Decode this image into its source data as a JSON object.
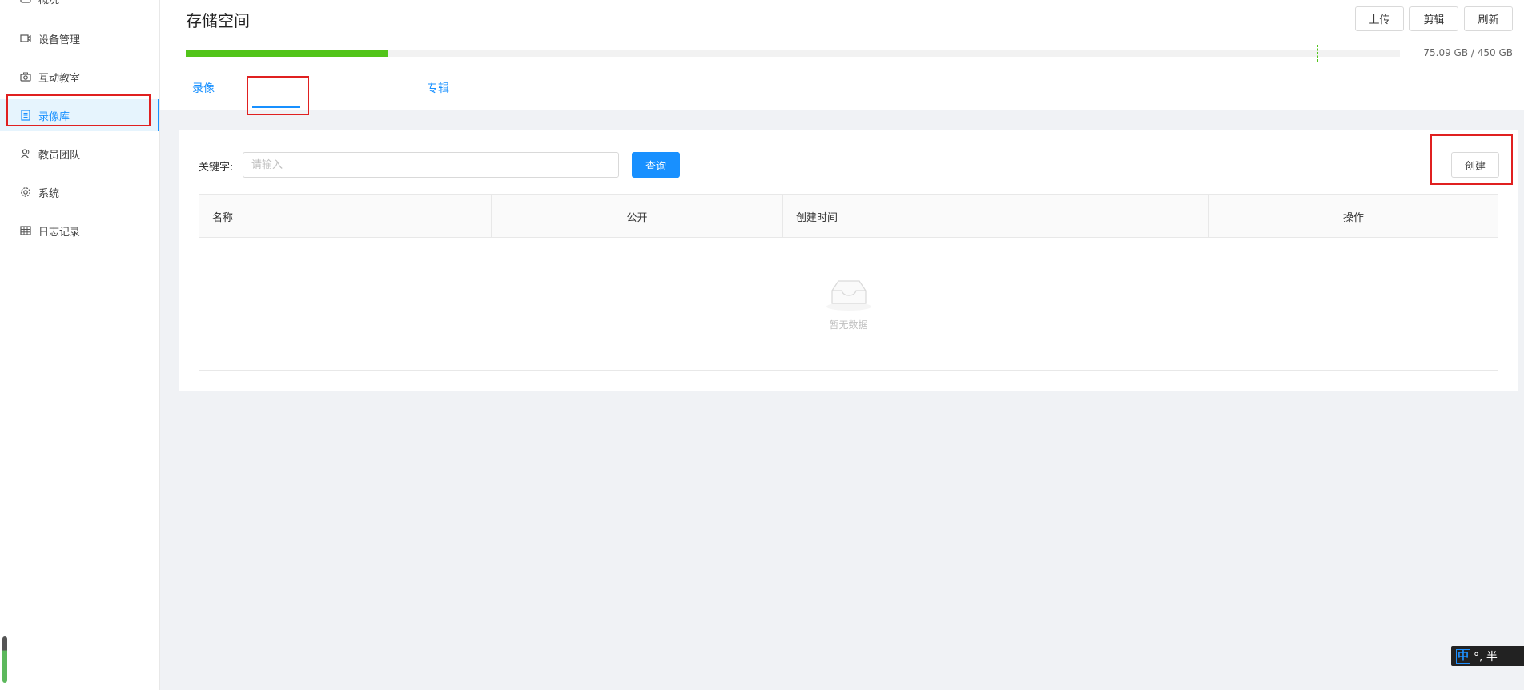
{
  "sidebar": {
    "items": [
      {
        "label": "概况",
        "icon": "dashboard-icon"
      },
      {
        "label": "设备管理",
        "icon": "video-device-icon"
      },
      {
        "label": "互动教室",
        "icon": "camera-icon"
      },
      {
        "label": "录像库",
        "icon": "book-icon",
        "active": true
      },
      {
        "label": "教员团队",
        "icon": "team-icon"
      },
      {
        "label": "系统",
        "icon": "gear-icon"
      },
      {
        "label": "日志记录",
        "icon": "table-icon"
      }
    ]
  },
  "header": {
    "title": "存储空间",
    "buttons": {
      "upload": "上传",
      "clip": "剪辑",
      "refresh": "刷新"
    },
    "storage": {
      "used_text": "75.09 GB / 450 GB",
      "used_gb": 75.09,
      "total_gb": 450,
      "fill_fraction": 0.1669
    },
    "tabs": [
      {
        "label": "录像",
        "active": false
      },
      {
        "label": "专辑",
        "active": true
      }
    ]
  },
  "search": {
    "label": "关键字:",
    "placeholder": "请输入",
    "value": "",
    "query_label": "查询",
    "create_label": "创建"
  },
  "table": {
    "columns": [
      "名称",
      "公开",
      "创建时间",
      "操作"
    ],
    "rows": [],
    "empty_text": "暂无数据"
  },
  "ime": {
    "mode": "中",
    "rest": "°, 半"
  },
  "colors": {
    "accent": "#1890ff",
    "progress": "#52c41a",
    "annotation": "#e02020"
  }
}
